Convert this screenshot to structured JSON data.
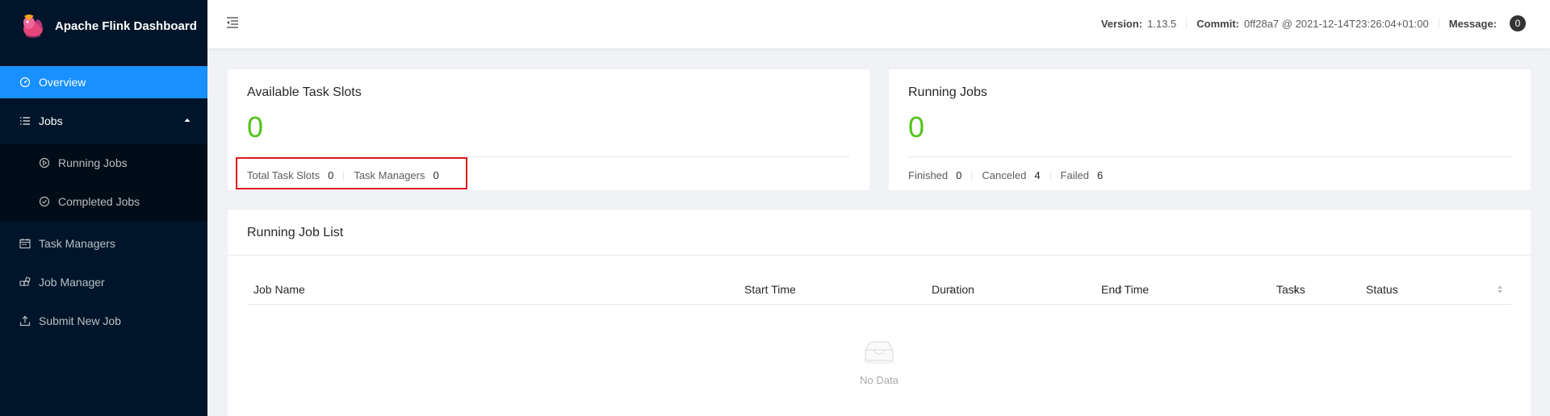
{
  "app": {
    "title": "Apache Flink Dashboard"
  },
  "sidebar": {
    "items": [
      {
        "label": "Overview",
        "icon": "dashboard-icon",
        "active": true
      },
      {
        "label": "Jobs",
        "icon": "bars-icon",
        "open": true
      },
      {
        "label": "Running Jobs",
        "icon": "play-circle-icon"
      },
      {
        "label": "Completed Jobs",
        "icon": "check-circle-icon"
      },
      {
        "label": "Task Managers",
        "icon": "schedule-icon"
      },
      {
        "label": "Job Manager",
        "icon": "build-icon"
      },
      {
        "label": "Submit New Job",
        "icon": "upload-icon"
      }
    ]
  },
  "header": {
    "version_label": "Version:",
    "version_value": "1.13.5",
    "commit_label": "Commit:",
    "commit_value": "0ff28a7 @ 2021-12-14T23:26:04+01:00",
    "message_label": "Message:",
    "message_count": "0"
  },
  "task_slots": {
    "title": "Available Task Slots",
    "available": "0",
    "total_label": "Total Task Slots",
    "total_value": "0",
    "tm_label": "Task Managers",
    "tm_value": "0"
  },
  "running_jobs": {
    "title": "Running Jobs",
    "count": "0",
    "finished_label": "Finished",
    "finished_value": "0",
    "canceled_label": "Canceled",
    "canceled_value": "4",
    "failed_label": "Failed",
    "failed_value": "6"
  },
  "job_list": {
    "title": "Running Job List",
    "columns": [
      "Job Name",
      "Start Time",
      "Duration",
      "End Time",
      "Tasks",
      "Status"
    ],
    "empty_text": "No Data"
  },
  "colors": {
    "sidebar_bg": "#001529",
    "active": "#1890ff",
    "success": "#52c41a",
    "highlight": "#e0191e"
  }
}
